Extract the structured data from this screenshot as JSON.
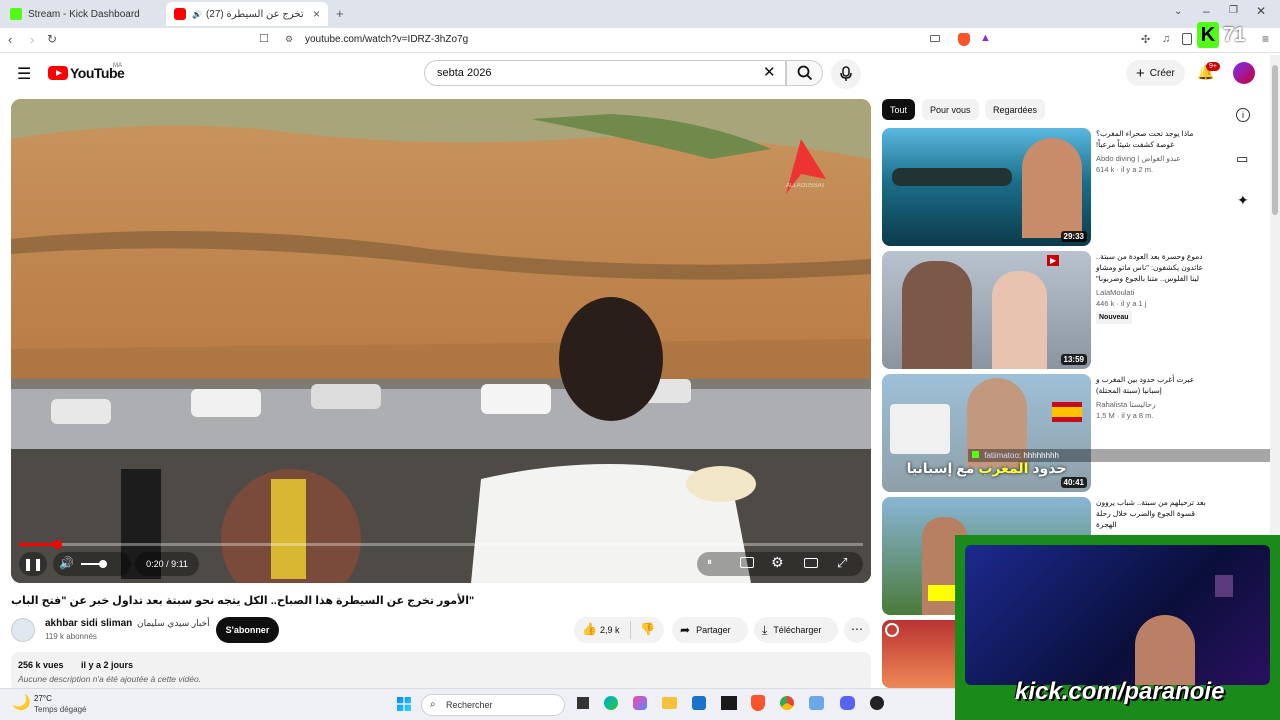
{
  "browser": {
    "tabs": [
      {
        "title": "Stream - Kick Dashboard"
      },
      {
        "title": "(27) الأمور تخرج عن السيطرة ..."
      }
    ],
    "url": "youtube.com/watch?v=IDRZ-3hZo7g",
    "ext_badge": "71"
  },
  "youtube": {
    "logo": "YouTube",
    "logo_country": "MA",
    "search_value": "sebta 2026",
    "create_label": "Créer",
    "notif_badge": "9+"
  },
  "player": {
    "time": "0:20 / 9:11",
    "progress_fraction": 0.045,
    "watermark": "ALLAOUSSAT"
  },
  "video": {
    "title": "\"الأمور تخرج عن السيطرة هذا الصباح.. الكل يتجه نحو سبتة بعد تداول خبر عن \"فتح الباب",
    "channel_name": "akhbar sidi sliman",
    "channel_arabic": "أخبار سيدي سليمان",
    "subscribers": "119 k abonnés",
    "subscribe_label": "S'abonner",
    "likes": "2,9 k",
    "share_label": "Partager",
    "download_label": "Télécharger",
    "views": "256 k vues",
    "age": "il y a 2 jours",
    "description": "Aucune description n'a été ajoutée à cette vidéo."
  },
  "sidebar": {
    "chips": [
      "Tout",
      "Pour vous",
      "Regardées"
    ],
    "items": [
      {
        "title": "ماذا يوجد تحت صحراء المغرب؟ غوصة كشفت شيئاً مرعباً!",
        "channel": "Abdo diving | عبدو الغواص",
        "meta": "614 k · il y a 2 m.",
        "duration": "29:33",
        "badge": ""
      },
      {
        "title": "دموع وحسرة بعد العودة من سبتة.. عائدون يكشفون: \"ناس ماتو ومشاو لينا الفلوس.. متنا بالجوع وضربونا\"",
        "channel": "LalaMoulati",
        "meta": "446 k · il y a 1 j",
        "duration": "13:59",
        "badge": "Nouveau"
      },
      {
        "title": "عبرت أغرب حدود بين المغرب و إسبانيا (سبتة المحتلة)",
        "channel": "Rahalista رحاليستا",
        "meta": "1,5 M · il y a 8 m.",
        "duration": "40:41",
        "badge": ""
      },
      {
        "title": "بعد ترحيلهم من سبتة.. شباب يروون قسوة الجوع والضرب خلال رحلة الهجرة",
        "channel": "",
        "meta": "",
        "duration": "",
        "badge": ""
      }
    ],
    "chat_overlay": {
      "user": "fatiimatoo",
      "message": "hhhhhhhh"
    }
  },
  "webcam": {
    "overlay_text": "kick.com/paranoie"
  },
  "taskbar": {
    "weather_temp": "27°C",
    "weather_desc": "Temps dégagé",
    "search_label": "Rechercher"
  }
}
